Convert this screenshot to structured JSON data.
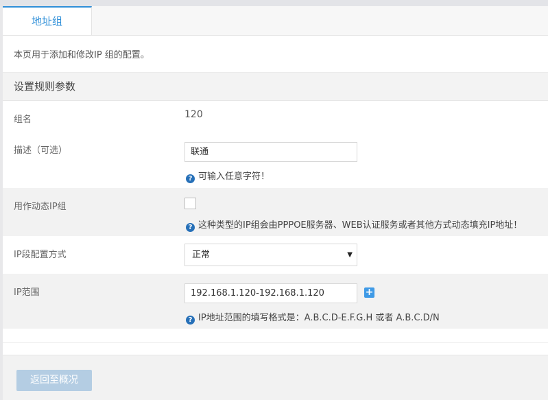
{
  "tabs": [
    {
      "label": "地址组",
      "active": true
    }
  ],
  "page_description": "本页用于添加和修改IP 组的配置。",
  "section_title": "设置规则参数",
  "fields": {
    "group_name": {
      "label": "组名",
      "value": "120"
    },
    "description": {
      "label": "描述（可选）",
      "value": "联通",
      "hint": "可输入任意字符！"
    },
    "dynamic": {
      "label": "用作动态IP组",
      "checked": false,
      "hint": "这种类型的IP组会由PPPOE服务器、WEB认证服务或者其他方式动态填充IP地址！"
    },
    "ip_mode": {
      "label": "IP段配置方式",
      "selected": "正常",
      "arrow": "▼"
    },
    "ip_range": {
      "label": "IP范围",
      "value": "192.168.1.120-192.168.1.120",
      "add_symbol": "+",
      "hint": "IP地址范围的填写格式是：A.B.C.D-E.F.G.H 或者 A.B.C.D/N"
    }
  },
  "hint_icon_glyph": "?",
  "footer": {
    "back_button": "返回至概况"
  },
  "colors": {
    "accent": "#2f8fd8",
    "hint_icon": "#2670b8",
    "add_button": "#3f9ae6",
    "back_button": "#b4cde3"
  }
}
